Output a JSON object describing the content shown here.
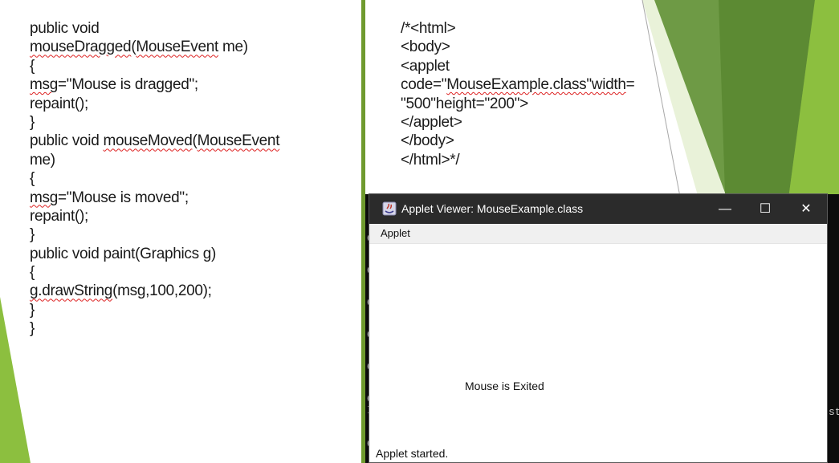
{
  "left_code": [
    [
      {
        "t": "public void"
      }
    ],
    [
      {
        "t": "mouseDragged",
        "sq": true
      },
      {
        "t": "("
      },
      {
        "t": "MouseEvent",
        "sq": true
      },
      {
        "t": " me)"
      }
    ],
    [
      {
        "t": "{"
      }
    ],
    [
      {
        "t": "msg",
        "sq": true
      },
      {
        "t": "=\"Mouse is dragged\";"
      }
    ],
    [
      {
        "t": "repaint();"
      }
    ],
    [
      {
        "t": "}"
      }
    ],
    [
      {
        "t": "public void "
      },
      {
        "t": "mouseMoved",
        "sq": true
      },
      {
        "t": "("
      },
      {
        "t": "MouseEvent",
        "sq": true
      }
    ],
    [
      {
        "t": "me)"
      }
    ],
    [
      {
        "t": "{"
      }
    ],
    [
      {
        "t": "msg",
        "sq": true
      },
      {
        "t": "=\"Mouse is moved\";"
      }
    ],
    [
      {
        "t": "repaint();"
      }
    ],
    [
      {
        "t": "}"
      }
    ],
    [
      {
        "t": "public void paint(Graphics g)"
      }
    ],
    [
      {
        "t": "{"
      }
    ],
    [
      {
        "t": "g.drawString",
        "sq": true
      },
      {
        "t": "(msg,100,200);"
      }
    ],
    [
      {
        "t": "}"
      }
    ],
    [
      {
        "t": "}"
      }
    ]
  ],
  "right_code": [
    [
      {
        "t": "/*<html>"
      }
    ],
    [
      {
        "t": "<body>"
      }
    ],
    [
      {
        "t": "<applet"
      }
    ],
    [
      {
        "t": "code=\""
      },
      {
        "t": "MouseExample.class\"width",
        "sq": true
      },
      {
        "t": "="
      }
    ],
    [
      {
        "t": "\"500\"height=\"200\">"
      }
    ],
    [
      {
        "t": "</applet>"
      }
    ],
    [
      {
        "t": "</body>"
      }
    ],
    [
      {
        "t": "</html>*/"
      }
    ]
  ],
  "console_left_chars": [
    "C",
    "C",
    "C",
    "C",
    "C",
    "C",
    "I",
    "C"
  ],
  "console_right_char": "st",
  "window": {
    "title": "Applet Viewer: MouseExample.class",
    "min_glyph": "—",
    "max_glyph": "☐",
    "close_glyph": "✕",
    "menu_label": "Applet",
    "message": "Mouse is Exited",
    "status": "Applet started."
  },
  "colors": {
    "accent_green": "#8cbf3f",
    "dark_green": "#5f8f2a",
    "titlebar": "#2b2b2b"
  }
}
